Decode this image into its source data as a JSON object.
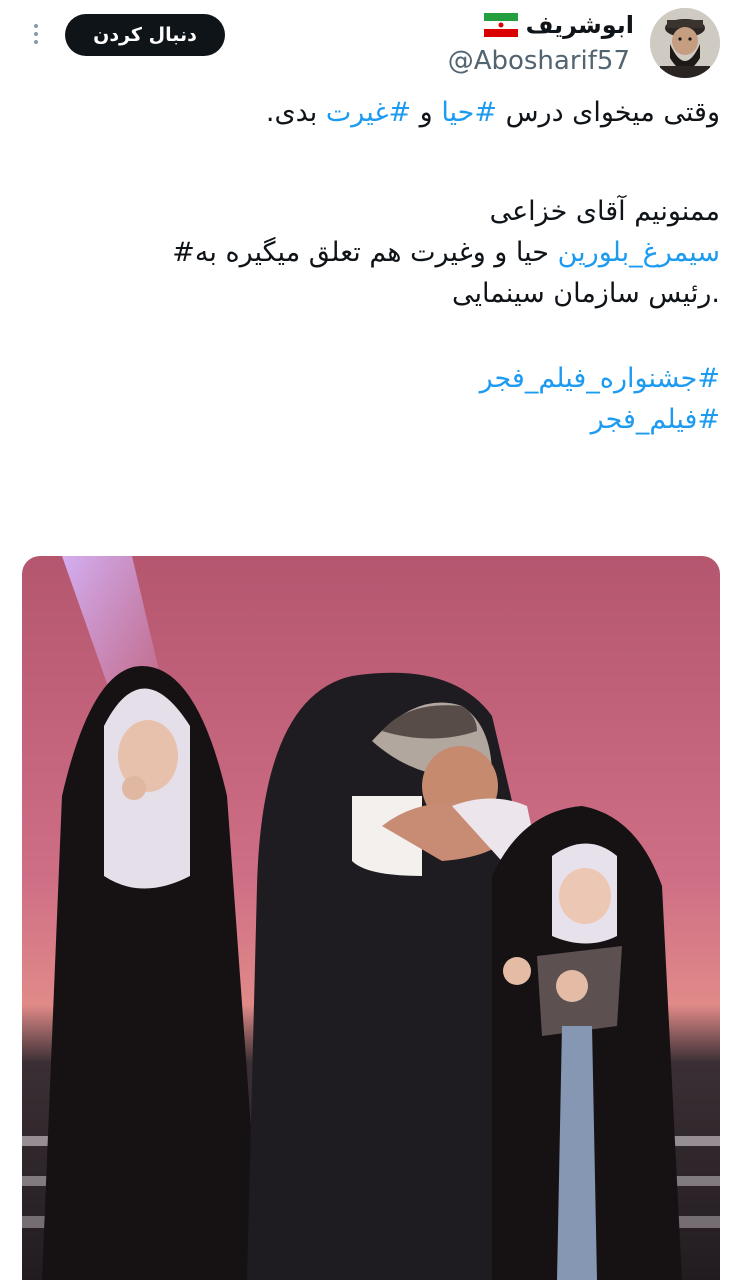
{
  "author": {
    "display_name": "ابوشریف",
    "handle": "@Abosharif57",
    "flag_icon": "iran-flag-icon",
    "avatar_icon": "profile-photo"
  },
  "actions": {
    "follow_label": "دنبال کردن",
    "more_icon": "more-vertical-icon"
  },
  "tweet": {
    "line1_before": "وقتی میخوای درس ",
    "line1_tag1": "#حیا",
    "line1_mid": " و ",
    "line1_tag2": "#غیرت",
    "line1_after": " بدی.",
    "line2": "ممنونیم آقای خزاعی",
    "line3_tag": "سیمرغ_بلورین",
    "line3_rest": " حیا و وغیرت هم تعلق میگیره به#",
    "line4": ".رئیس سازمان سینمایی",
    "tag_line5": "#جشنواره_فیلم_فجر",
    "tag_line6": "#فیلم_فجر"
  },
  "media": {
    "kind": "photo",
    "colors": {
      "backdrop": "#c05b7c",
      "stage": "#2a2326",
      "chador": "#161214",
      "suit": "#1e1c20",
      "hijab": "#e9e4ea"
    }
  },
  "colors": {
    "link": "#1d9bf0",
    "text": "#0f1419",
    "muted": "#536471",
    "button": "#0f1419"
  }
}
